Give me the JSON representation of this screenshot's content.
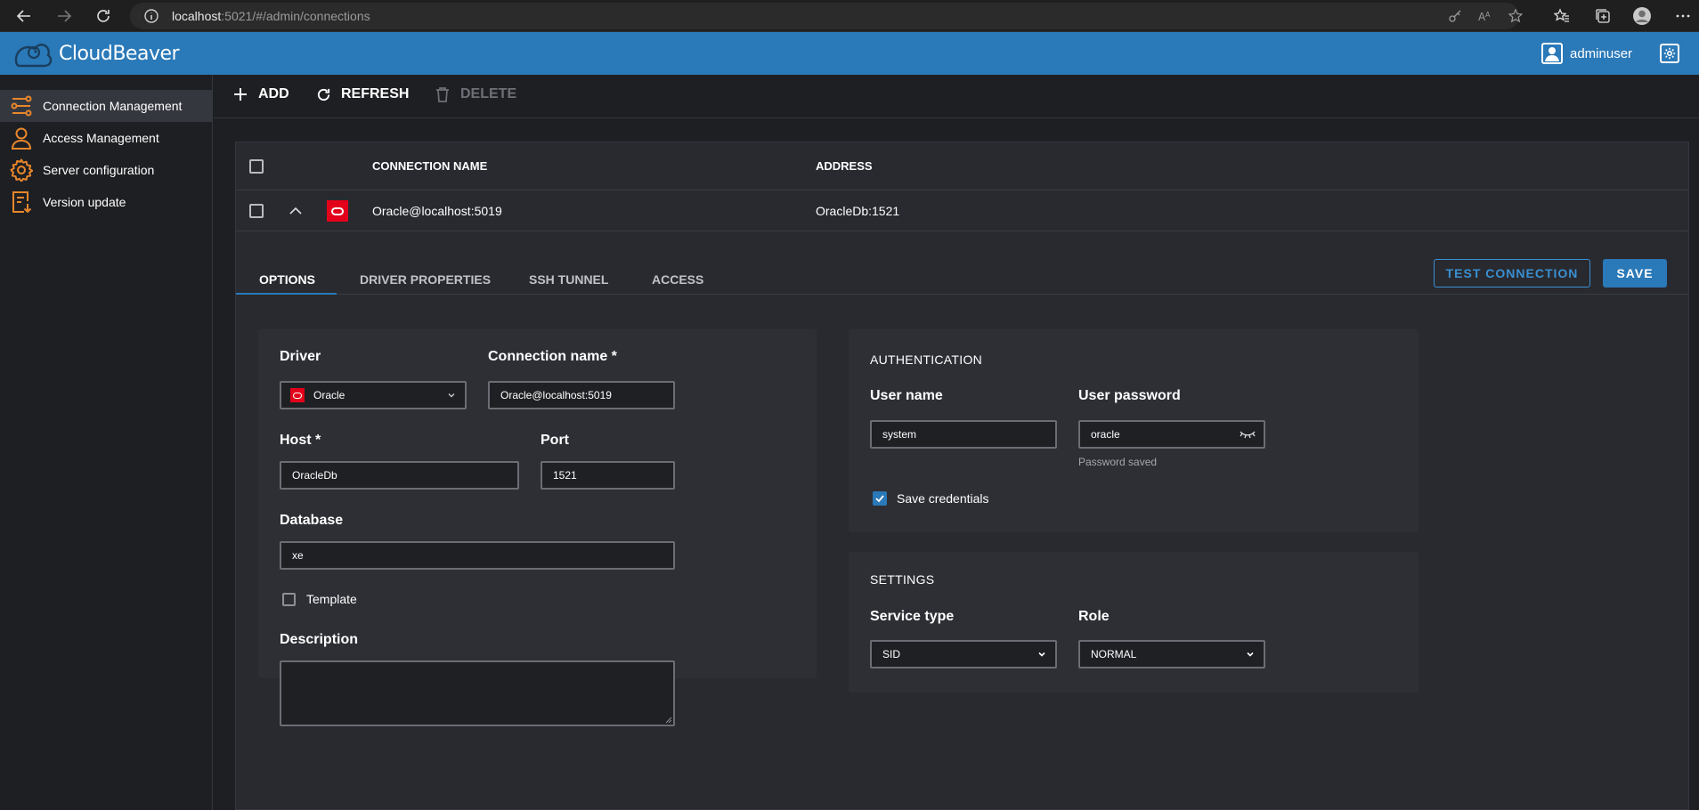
{
  "browser": {
    "url_host": "localhost",
    "url_path": ":5021/#/admin/connections"
  },
  "header": {
    "logo_text": "CloudBeaver",
    "user_name": "adminuser"
  },
  "sidebar": {
    "items": [
      {
        "label": "Connection Management"
      },
      {
        "label": "Access Management"
      },
      {
        "label": "Server configuration"
      },
      {
        "label": "Version update"
      }
    ]
  },
  "toolbar": {
    "add_label": "ADD",
    "refresh_label": "REFRESH",
    "delete_label": "DELETE"
  },
  "table": {
    "headers": {
      "name": "CONNECTION NAME",
      "address": "ADDRESS"
    },
    "rows": [
      {
        "name": "Oracle@localhost:5019",
        "address": "OracleDb:1521"
      }
    ]
  },
  "tabs": {
    "items": [
      {
        "label": "OPTIONS"
      },
      {
        "label": "DRIVER PROPERTIES"
      },
      {
        "label": "SSH TUNNEL"
      },
      {
        "label": "ACCESS"
      }
    ],
    "test_connection_label": "TEST CONNECTION",
    "save_label": "SAVE"
  },
  "options": {
    "driver_label": "Driver",
    "driver_value": "Oracle",
    "connection_name_label": "Connection name *",
    "connection_name_value": "Oracle@localhost:5019",
    "host_label": "Host *",
    "host_value": "OracleDb",
    "port_label": "Port",
    "port_value": "1521",
    "database_label": "Database",
    "database_value": "xe",
    "template_label": "Template",
    "description_label": "Description"
  },
  "authentication": {
    "title": "AUTHENTICATION",
    "user_name_label": "User name",
    "user_name_value": "system",
    "password_label": "User password",
    "password_value": "oracle",
    "password_hint": "Password saved",
    "save_credentials_label": "Save credentials"
  },
  "settings": {
    "title": "SETTINGS",
    "service_type_label": "Service type",
    "service_type_value": "SID",
    "role_label": "Role",
    "role_value": "NORMAL"
  },
  "colors": {
    "accent": "#2a79b8",
    "oracle_red": "#e3001b",
    "sidebar_icon": "#e8872b"
  }
}
